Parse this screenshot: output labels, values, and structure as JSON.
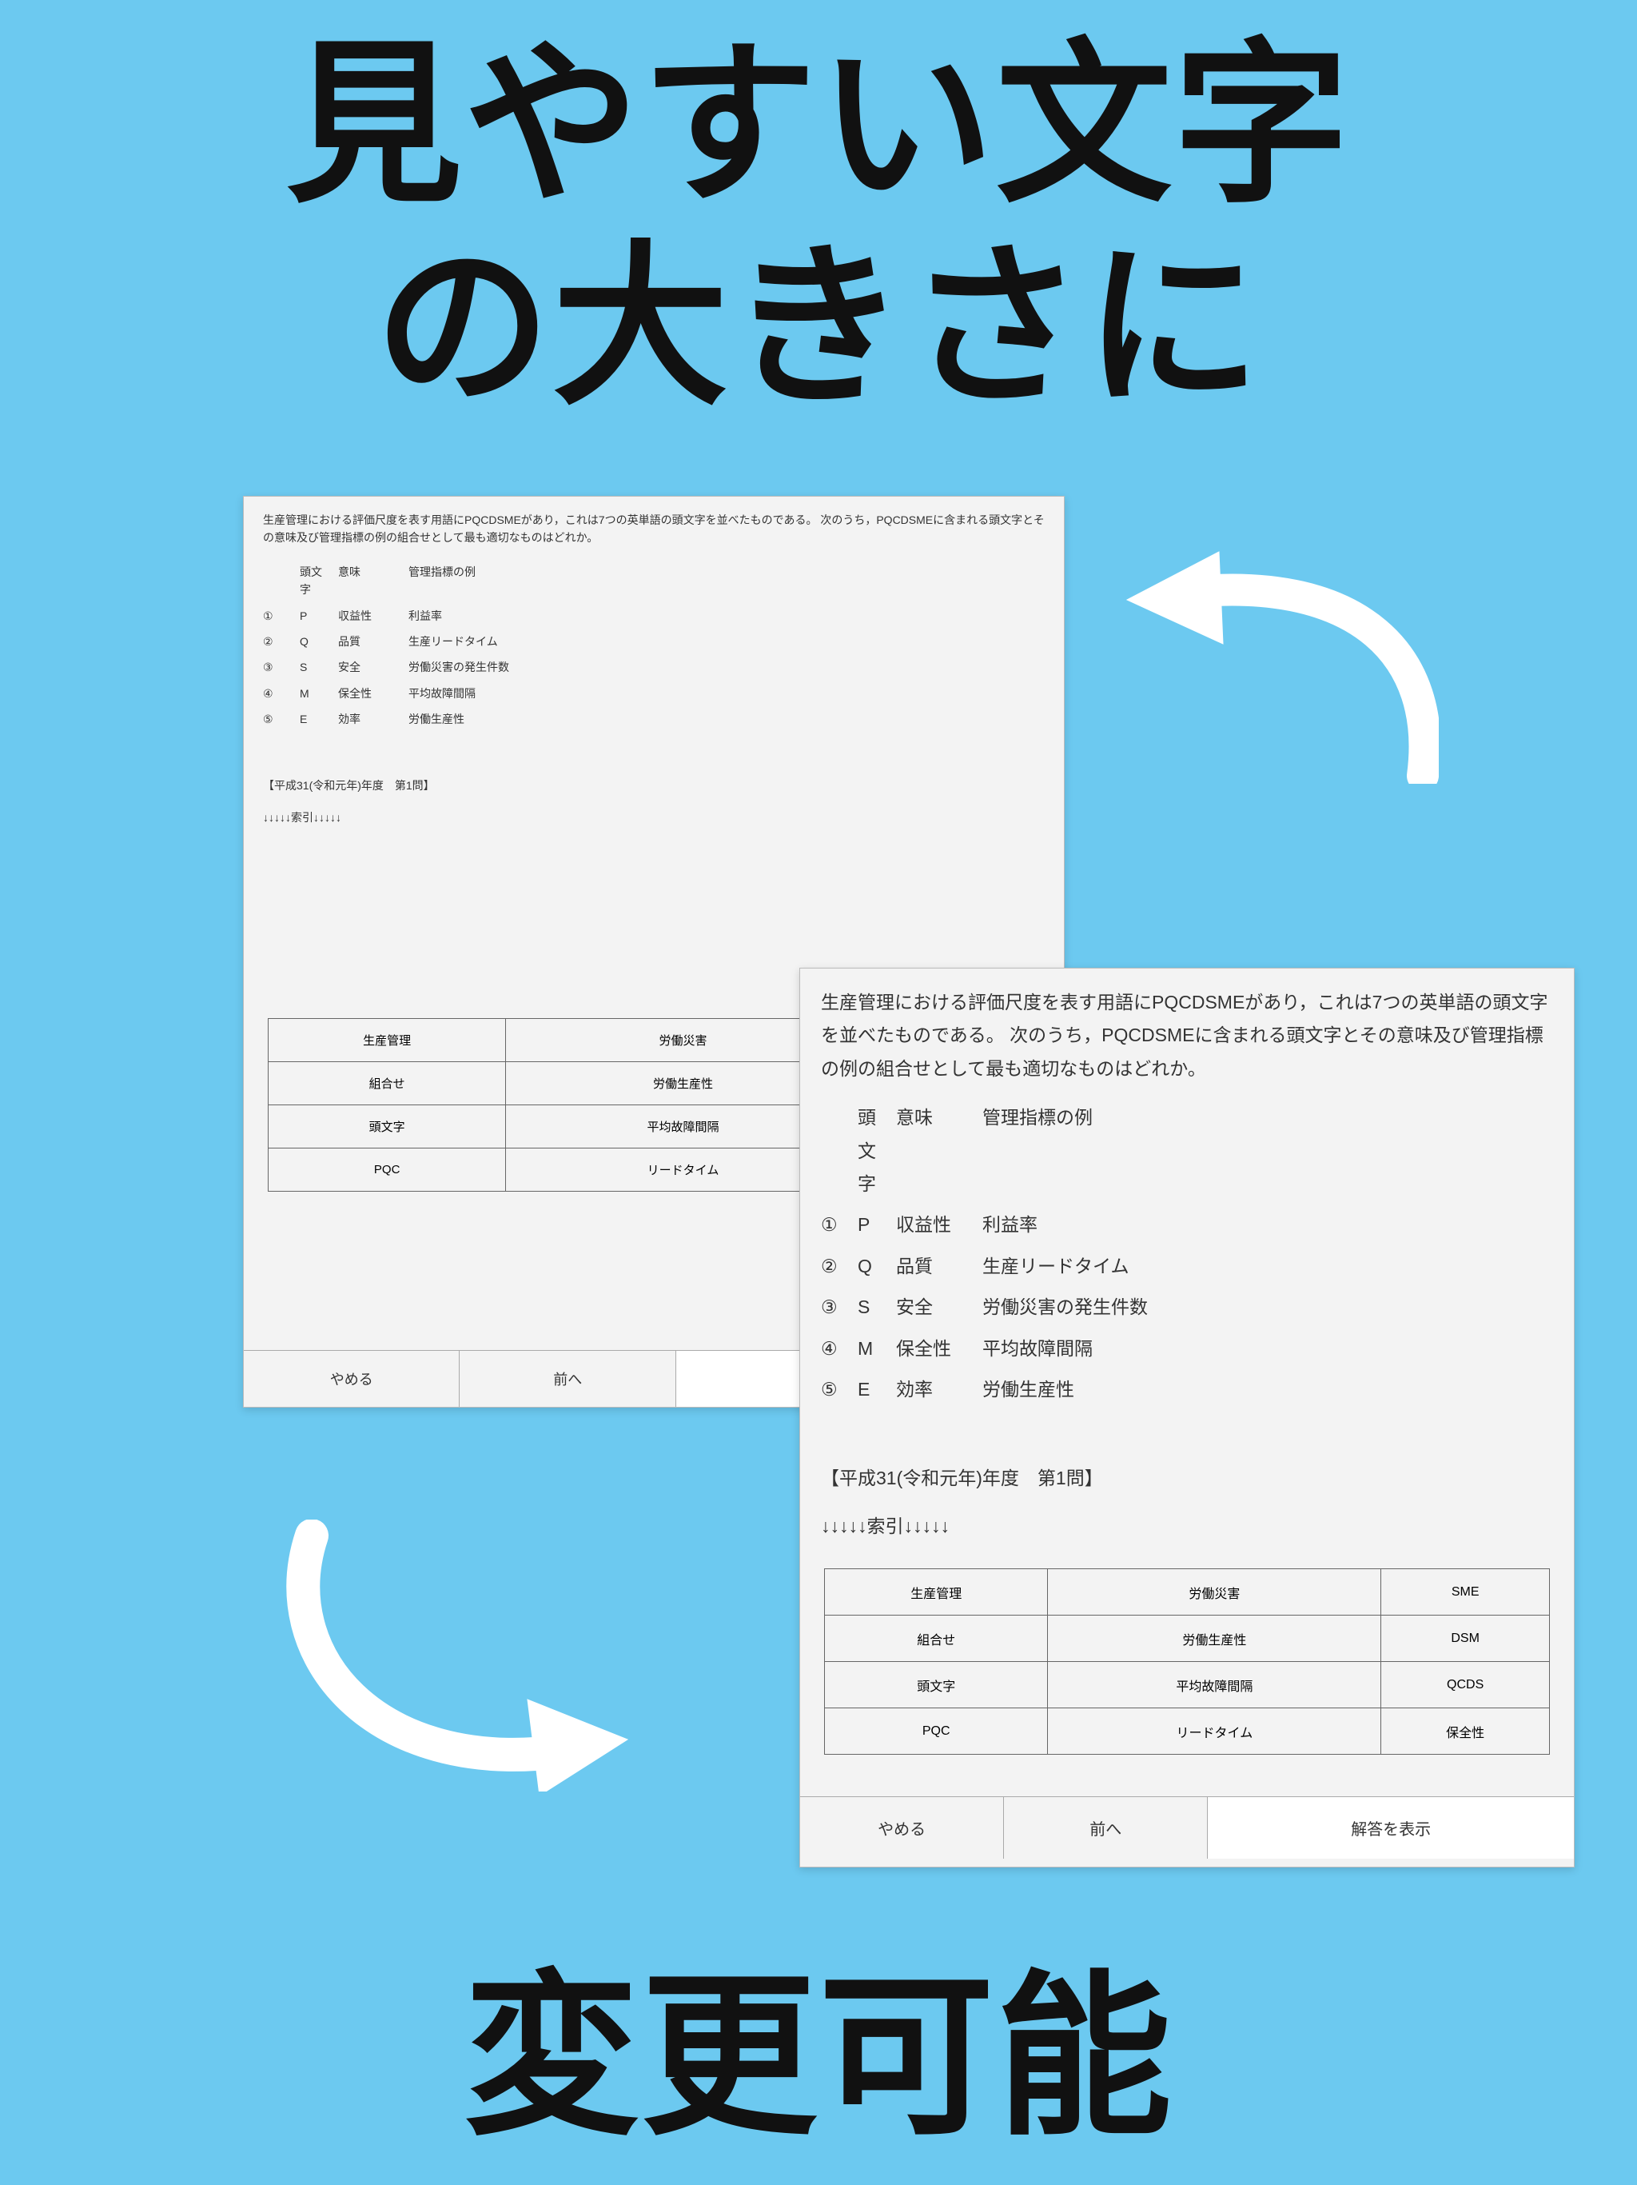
{
  "headline": {
    "line1": "見やすい文字",
    "line2": "の大きさに"
  },
  "footer": "変更可能",
  "question": {
    "text": "生産管理における評価尺度を表す用語にPQCDSMEがあり，これは7つの英単語の頭文字を並べたものである。 次のうち，PQCDSMEに含まれる頭文字とその意味及び管理指標の例の組合せとして最も適切なものはどれか。",
    "header": {
      "col1": "頭文字",
      "col2": "意味",
      "col3": "管理指標の例"
    },
    "options": [
      {
        "num": "①",
        "letter": "P",
        "mean": "収益性",
        "ex": "利益率"
      },
      {
        "num": "②",
        "letter": "Q",
        "mean": "品質",
        "ex": "生産リードタイム"
      },
      {
        "num": "③",
        "letter": "S",
        "mean": "安全",
        "ex": "労働災害の発生件数"
      },
      {
        "num": "④",
        "letter": "M",
        "mean": "保全性",
        "ex": "平均故障間隔"
      },
      {
        "num": "⑤",
        "letter": "E",
        "mean": "効率",
        "ex": "労働生産性"
      }
    ],
    "meta": "【平成31(令和元年)年度　第1問】",
    "index_line": "↓↓↓↓↓索引↓↓↓↓↓"
  },
  "grid": [
    [
      "生産管理",
      "労働災害",
      "SME"
    ],
    [
      "組合せ",
      "労働生産性",
      "DSM"
    ],
    [
      "頭文字",
      "平均故障間隔",
      "QCDS"
    ],
    [
      "PQC",
      "リードタイム",
      "保全性"
    ]
  ],
  "buttons": {
    "quit": "やめる",
    "prev": "前へ",
    "show": "解答を表示"
  }
}
